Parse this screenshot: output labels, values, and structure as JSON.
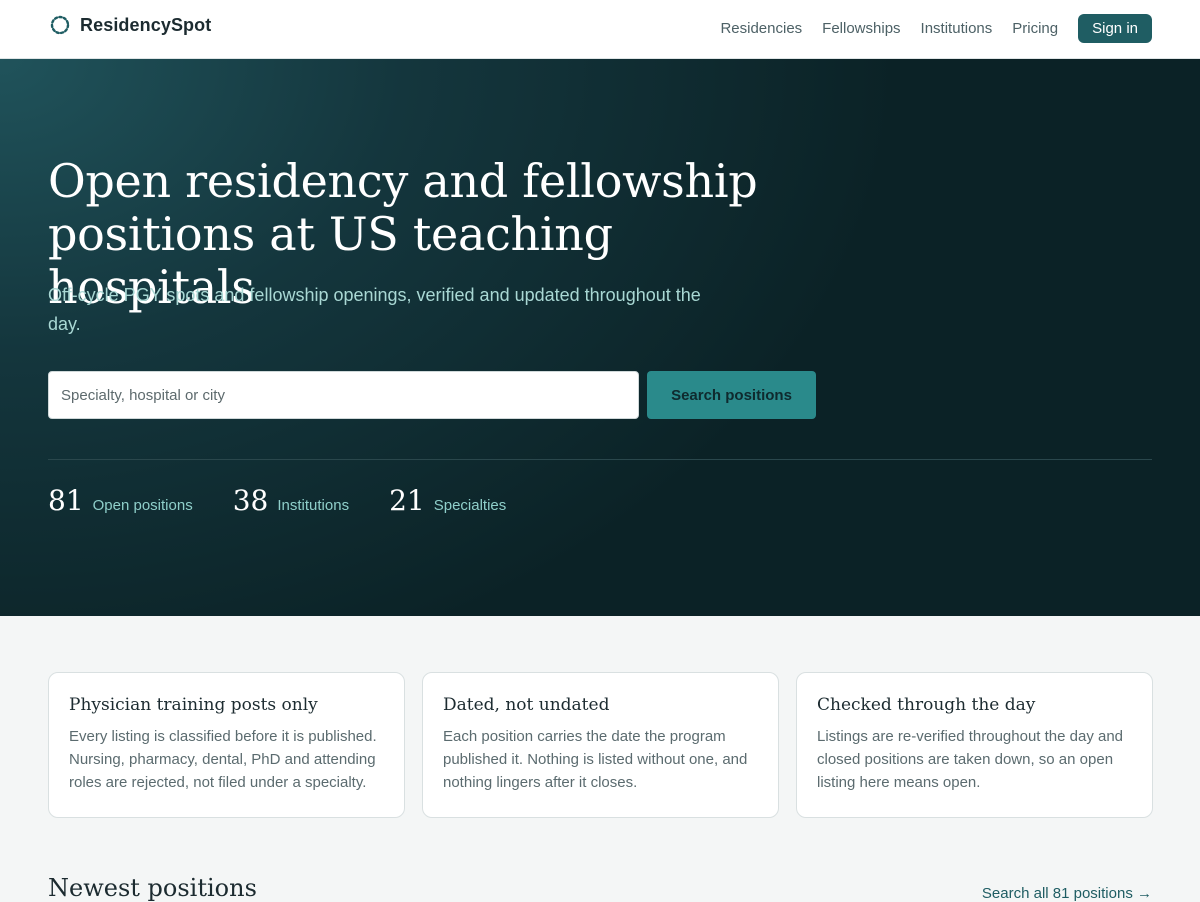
{
  "brand": {
    "name": "ResidencySpot",
    "logo_icon": "dotted-ring-icon",
    "accent_color": "#1f5d63"
  },
  "nav": {
    "links": [
      "Residencies",
      "Fellowships",
      "Institutions",
      "Pricing"
    ],
    "signin_label": "Sign in"
  },
  "hero": {
    "title": "Open residency and fellowship positions at US teaching hospitals",
    "subtitle": "Off-cycle PGY spots and fellowship openings, verified and updated throughout the day.",
    "search": {
      "placeholder": "Specialty, hospital or city",
      "value": "",
      "button_label": "Search positions"
    },
    "stats": [
      {
        "value": "81",
        "label": "Open positions"
      },
      {
        "value": "38",
        "label": "Institutions"
      },
      {
        "value": "21",
        "label": "Specialties"
      }
    ]
  },
  "features": [
    {
      "title": "Physician training posts only",
      "body": "Every listing is classified before it is published. Nursing, pharmacy, dental, PhD and attending roles are rejected, not filed under a specialty."
    },
    {
      "title": "Dated, not undated",
      "body": "Each position carries the date the program published it. Nothing is listed without one, and nothing lingers after it closes."
    },
    {
      "title": "Checked through the day",
      "body": "Listings are re-verified throughout the day and closed positions are taken down, so an open listing here means open."
    }
  ],
  "newest": {
    "title": "Newest positions",
    "link_label": "Search all 81 positions →"
  }
}
